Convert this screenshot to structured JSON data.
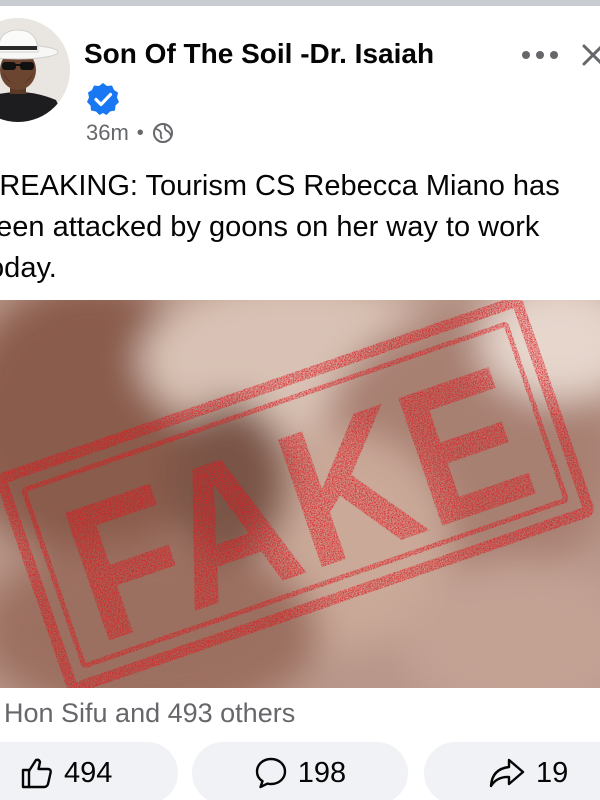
{
  "post": {
    "author_name": "Son Of The Soil -Dr. Isaiah",
    "time": "36m",
    "separator": "•",
    "text": "BREAKING: Tourism CS Rebecca Miano has been attacked by goons on her way to work today."
  },
  "image": {
    "stamp_text": "FAKE",
    "stamp_color": "#e0141c"
  },
  "reactions": {
    "summary": "Hon Sifu and 493 others"
  },
  "actions": {
    "like_count": "494",
    "comment_count": "198",
    "share_count": "19"
  },
  "icons": {
    "avatar": "avatar-photo",
    "verified": "verified-badge-icon",
    "audience": "globe-icon",
    "more": "more-options-icon",
    "close": "close-icon",
    "like": "thumbs-up-icon",
    "comment": "comment-bubble-icon",
    "share": "share-arrow-icon"
  },
  "colors": {
    "verified_blue": "#1877f2",
    "text_primary": "#050505",
    "text_secondary": "#65676b",
    "pill_bg": "#f0f2f5"
  }
}
